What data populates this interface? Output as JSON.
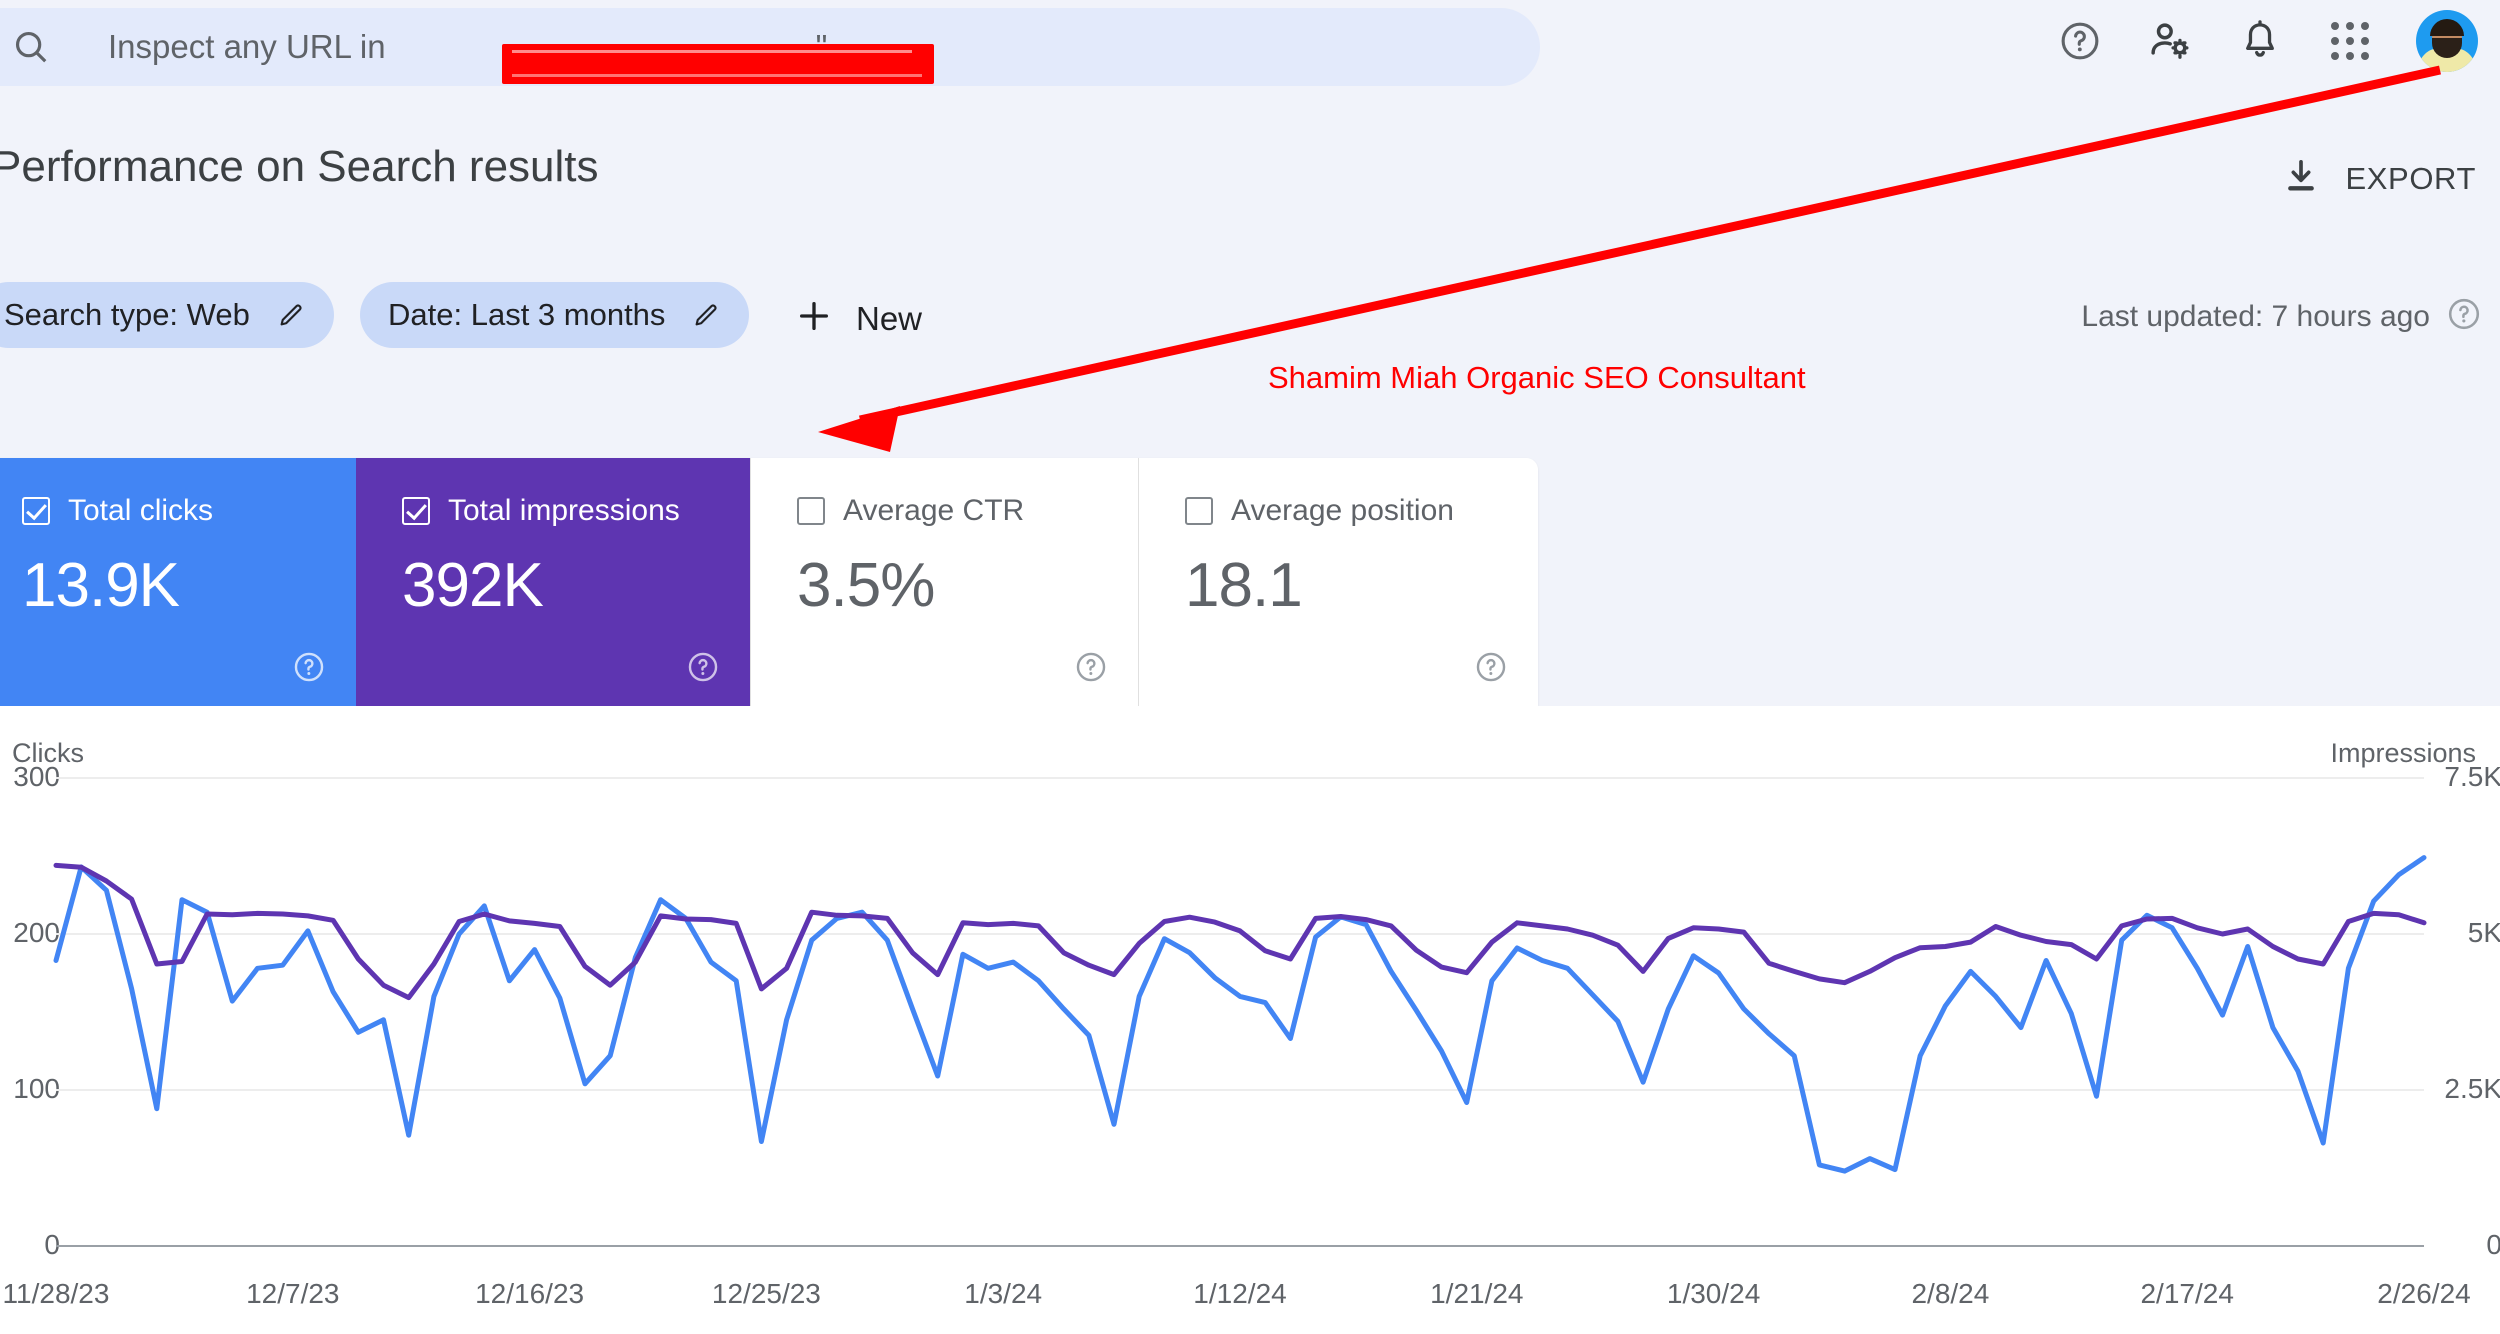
{
  "search": {
    "placeholder": "Inspect any URL in",
    "redacted_suffix": "\"",
    "icon": "search-icon"
  },
  "header": {
    "icons": [
      "help-icon",
      "user-settings-icon",
      "notifications-bell-icon",
      "apps-grid-icon"
    ],
    "avatar_alt": "user-avatar"
  },
  "page": {
    "title": "Performance on Search results",
    "export_label": "EXPORT",
    "export_icon": "download-icon"
  },
  "filters": {
    "chips": [
      {
        "label": "Search type: Web",
        "edit_icon": "pencil-icon"
      },
      {
        "label": "Date: Last 3 months",
        "edit_icon": "pencil-icon"
      }
    ],
    "new_label": "New",
    "new_icon": "plus-icon",
    "last_updated": "Last updated: 7 hours ago",
    "last_updated_help": "help-icon"
  },
  "annotation": {
    "text": "Shamim Miah Organic SEO Consultant",
    "color": "#FF0000"
  },
  "metrics": [
    {
      "label": "Total clicks",
      "value": "13.9K",
      "checked": true,
      "bg": "#4285F4",
      "text": "light"
    },
    {
      "label": "Total impressions",
      "value": "392K",
      "checked": true,
      "bg": "#5E35B1",
      "text": "light"
    },
    {
      "label": "Average CTR",
      "value": "3.5%",
      "checked": false,
      "bg": "#FFFFFF",
      "text": "dark"
    },
    {
      "label": "Average position",
      "value": "18.1",
      "checked": false,
      "bg": "#FFFFFF",
      "text": "dark"
    }
  ],
  "chart_data": {
    "type": "line",
    "title": "",
    "xlabel": "",
    "grid": true,
    "legend_position": "none",
    "y_left": {
      "label": "Clicks",
      "ticks": [
        "300",
        "200",
        "100",
        "0"
      ],
      "ylim": [
        0,
        300
      ],
      "color": "#4285F4"
    },
    "y_right": {
      "label": "Impressions",
      "ticks": [
        "7.5K",
        "5K",
        "2.5K",
        "0"
      ],
      "ylim": [
        0,
        7500
      ],
      "color": "#5E35B1"
    },
    "x_ticks": [
      "11/28/23",
      "12/7/23",
      "12/16/23",
      "12/25/23",
      "1/3/24",
      "1/12/24",
      "1/21/24",
      "1/30/24",
      "2/8/24",
      "2/17/24",
      "2/26/24"
    ],
    "series": [
      {
        "name": "Clicks",
        "color": "#4285F4",
        "axis": "left",
        "values": [
          183,
          243,
          228,
          165,
          88,
          222,
          214,
          157,
          178,
          180,
          202,
          163,
          137,
          145,
          71,
          160,
          200,
          218,
          170,
          190,
          159,
          104,
          122,
          185,
          222,
          210,
          182,
          170,
          67,
          145,
          196,
          210,
          214,
          196,
          152,
          109,
          187,
          178,
          182,
          170,
          152,
          135,
          78,
          160,
          197,
          188,
          172,
          160,
          156,
          133,
          198,
          211,
          206,
          176,
          151,
          125,
          92,
          170,
          191,
          183,
          178,
          161,
          144,
          105,
          152,
          186,
          175,
          152,
          136,
          122,
          52,
          48,
          56,
          49,
          122,
          154,
          176,
          160,
          140,
          183,
          149,
          96,
          196,
          212,
          204,
          178,
          148,
          192,
          140,
          112,
          66,
          178,
          221,
          238,
          249
        ]
      },
      {
        "name": "Impressions",
        "color": "#5E35B1",
        "axis": "right",
        "values": [
          6100,
          6070,
          5850,
          5560,
          4520,
          4560,
          5320,
          5310,
          5330,
          5320,
          5290,
          5220,
          4600,
          4180,
          3980,
          4520,
          5200,
          5320,
          5210,
          5170,
          5120,
          4480,
          4180,
          4550,
          5290,
          5240,
          5230,
          5170,
          4120,
          4450,
          5350,
          5300,
          5290,
          5250,
          4700,
          4350,
          5180,
          5150,
          5170,
          5130,
          4700,
          4500,
          4350,
          4850,
          5200,
          5270,
          5190,
          5050,
          4730,
          4600,
          5250,
          5280,
          5230,
          5130,
          4740,
          4470,
          4380,
          4870,
          5180,
          5130,
          5080,
          4980,
          4820,
          4400,
          4930,
          5100,
          5080,
          5030,
          4530,
          4400,
          4280,
          4220,
          4400,
          4620,
          4780,
          4800,
          4870,
          5120,
          4980,
          4880,
          4830,
          4600,
          5130,
          5240,
          5250,
          5100,
          5000,
          5080,
          4800,
          4600,
          4520,
          5200,
          5330,
          5310,
          5180
        ]
      }
    ]
  }
}
